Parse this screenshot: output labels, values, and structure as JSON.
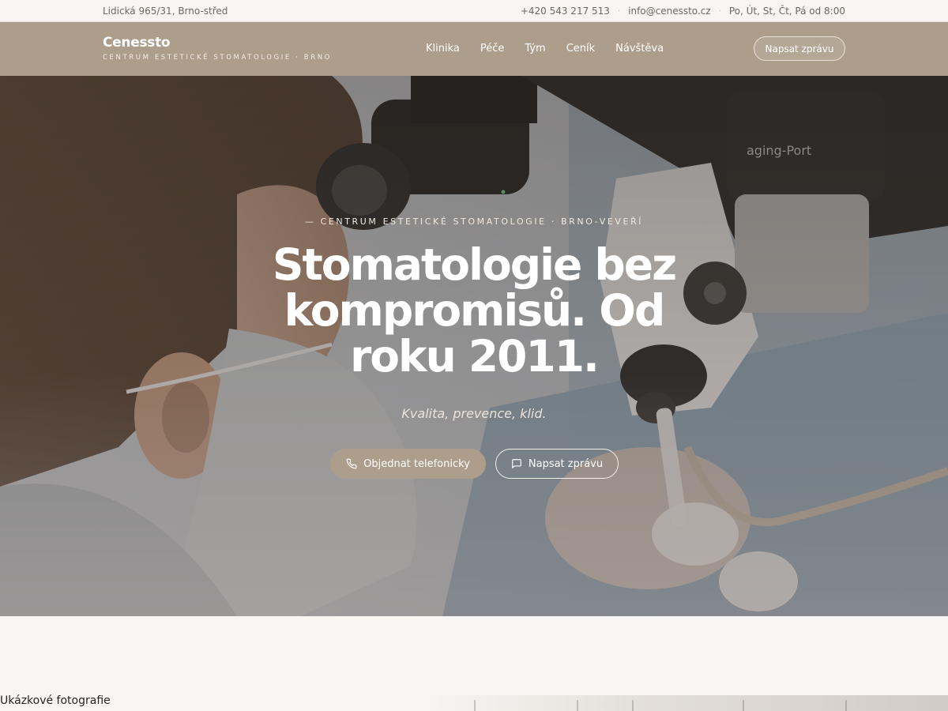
{
  "topbar": {
    "address": "Lidická 965/31, Brno-střed",
    "phone": "+420 543 217 513",
    "email": "info@cenessto.cz",
    "hours": "Po, Út, St, Čt, Pá od 8:00",
    "separator": "·"
  },
  "navbar": {
    "brand_name": "Cenessto",
    "brand_tagline": "CENTRUM ESTETICKÉ STOMATOLOGIE · BRNO",
    "links": [
      "Klinika",
      "Péče",
      "Tým",
      "Ceník",
      "Návštěva"
    ],
    "cta_label": "Napsat zprávu"
  },
  "hero": {
    "eyebrow": "— CENTRUM ESTETICKÉ STOMATOLOGIE · BRNO-VEVEŘÍ",
    "title": "Stomatologie bez kompromisů. Od roku 2011.",
    "subtitle": "Kvalita, prevence, klid.",
    "primary_button": "Objednat telefonicky",
    "primary_icon": "phone-icon",
    "secondary_button": "Napsat zprávu",
    "secondary_icon": "chat-icon"
  },
  "footer_note": "Ukázkové fotografie",
  "colors": {
    "accent": "#ad9e8b",
    "background": "#f8f5f2",
    "text": "#2c2722"
  }
}
